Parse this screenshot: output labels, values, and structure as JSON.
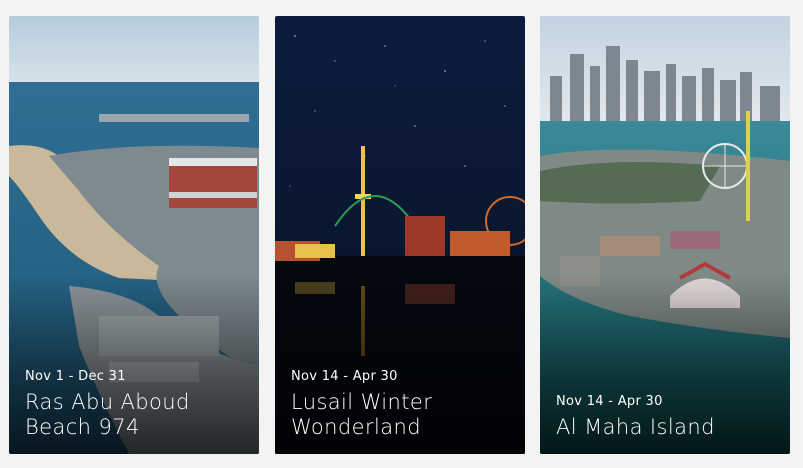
{
  "events": [
    {
      "date": "Nov 1 - Dec 31",
      "title": "Ras Abu Aboud Beach 974"
    },
    {
      "date": "Nov 14 - Apr 30",
      "title": "Lusail Winter Wonderland"
    },
    {
      "date": "Nov 14 - Apr 30",
      "title": "Al Maha Island"
    }
  ],
  "colors": {
    "page_background": "#f3f3f3",
    "text": "#ffffff"
  }
}
